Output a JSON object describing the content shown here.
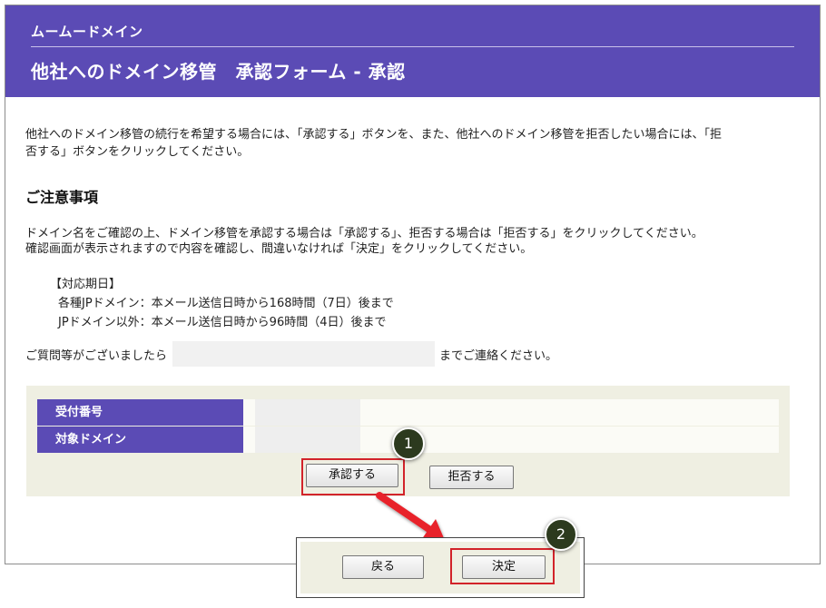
{
  "header": {
    "brand": "ムームードメイン",
    "title": "他社へのドメイン移管　承認フォーム - 承認"
  },
  "intro": {
    "line1": "他社へのドメイン移管の続行を希望する場合には、「承認する」ボタンを、また、他社へのドメイン移管を拒否したい場合には、「拒",
    "line2": "否する」ボタンをクリックしてください。"
  },
  "notes": {
    "heading": "ご注意事項",
    "line1": "ドメイン名をご確認の上、ドメイン移管を承認する場合は「承認する」、拒否する場合は「拒否する」をクリックしてください。",
    "line2": "確認画面が表示されますので内容を確認し、間違いなければ「決定」をクリックしてください。"
  },
  "period": {
    "title": "【対応期日】",
    "jp_domains": "各種JPドメイン：本メール送信日時から168時間（7日）後まで",
    "non_jp_domains": "JPドメイン以外：本メール送信日時から96時間（4日）後まで"
  },
  "contact": {
    "before": "ご質問等がございましたら",
    "after": "までご連絡ください。"
  },
  "form": {
    "rows": [
      {
        "label": "受付番号"
      },
      {
        "label": "対象ドメイン"
      }
    ],
    "approve_label": "承認する",
    "reject_label": "拒否する"
  },
  "confirm": {
    "back_label": "戻る",
    "submit_label": "決定"
  },
  "callouts": [
    "1",
    "2"
  ],
  "colors": {
    "brand_purple": "#5b4bb5",
    "highlight_red": "#d2232a",
    "panel_beige": "#efefe2",
    "callout_dark": "#2c3a1e"
  }
}
